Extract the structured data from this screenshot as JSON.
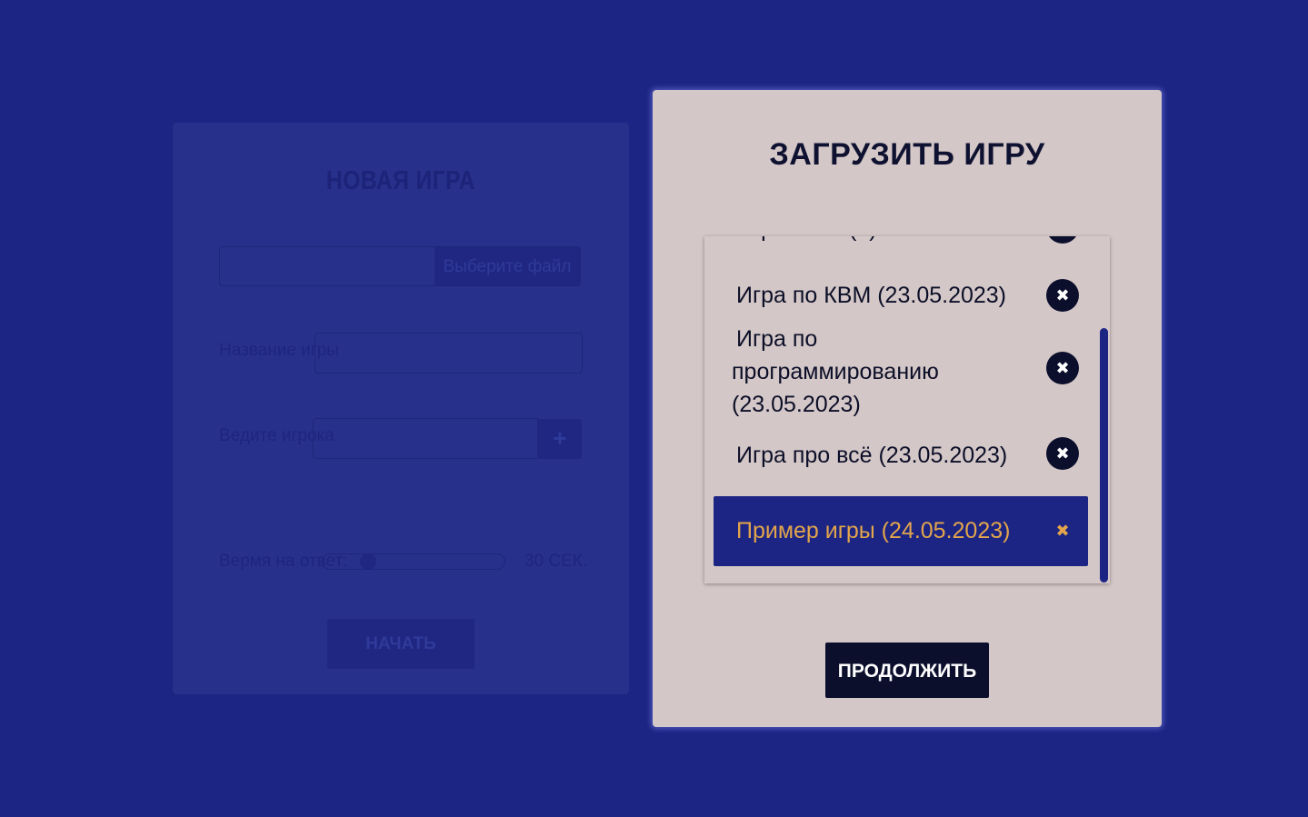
{
  "new_game": {
    "title": "НОВАЯ ИГРА",
    "file_button": "Выберите файл",
    "game_name_label": "Название игры",
    "player_label": "Ведите игрока",
    "add_player": "+",
    "time_label": "Вермя на ответ:",
    "time_value": "30 СЕК.",
    "time_slider_fraction": 0.25,
    "start_button": "НАЧАТЬ"
  },
  "load_game": {
    "title": "ЗАГРУЗИТЬ ИГРУ",
    "games": [
      {
        "name": "Игра по ... (..)",
        "delete_icon": "close-icon"
      },
      {
        "name": "Игра по КВМ (23.05.2023)",
        "delete_icon": "close-icon"
      },
      {
        "name": "Игра по программированию (23.05.2023)",
        "delete_icon": "close-icon"
      },
      {
        "name": "Игра про всё (23.05.2023)",
        "delete_icon": "close-icon"
      },
      {
        "name": "Пример игры (24.05.2023)",
        "delete_icon": "close-icon",
        "selected": true
      }
    ],
    "delete_glyph": "✖",
    "continue_button": "ПРОДОЛЖИТЬ"
  },
  "colors": {
    "background": "#1c2584",
    "modal": "#d4c7c7",
    "dark": "#0b0f2c",
    "selected_text": "#e3a54c"
  }
}
